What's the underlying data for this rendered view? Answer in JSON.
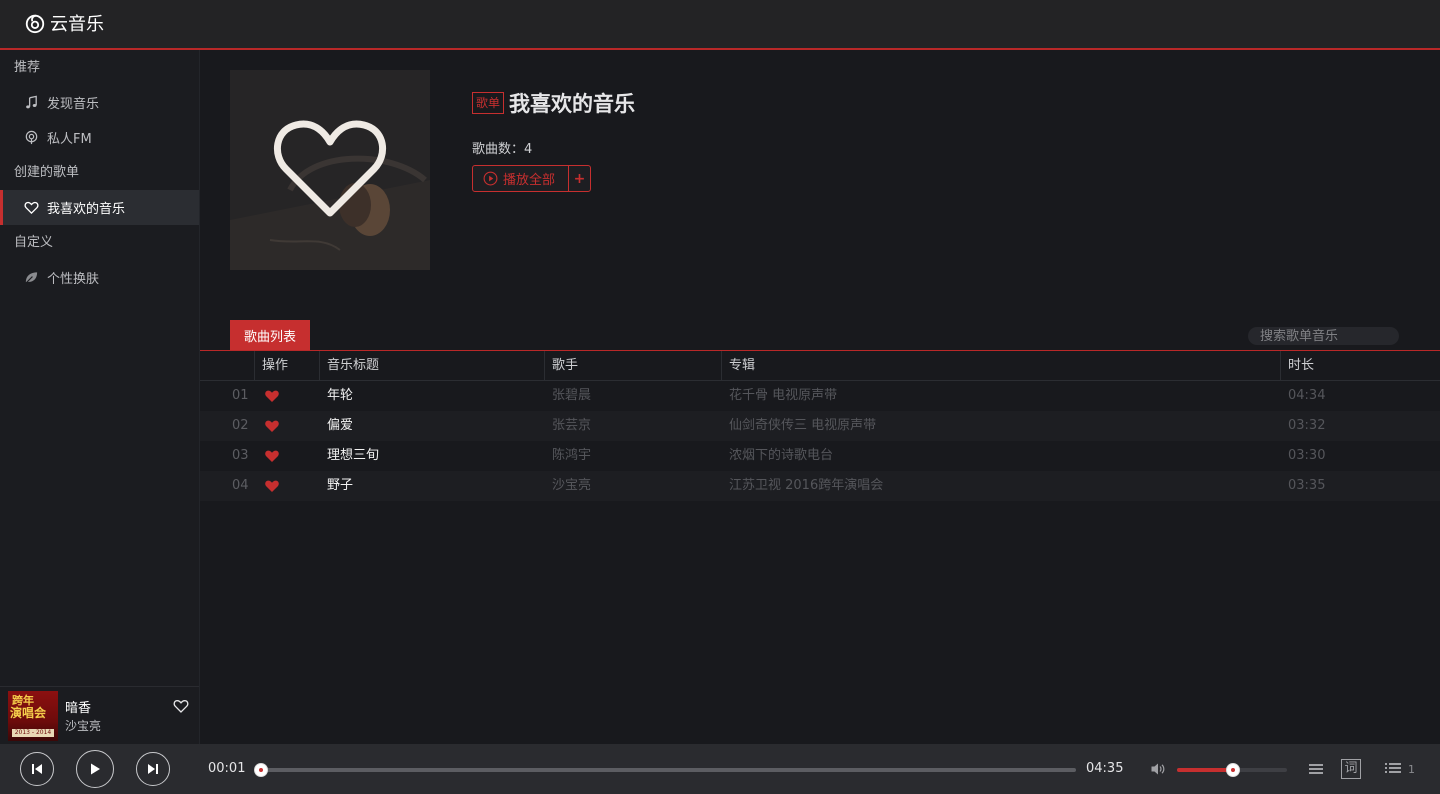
{
  "app": {
    "name": "云音乐",
    "accent": "#c62f2f"
  },
  "sidebar": {
    "groups": [
      {
        "title": "推荐",
        "items": [
          {
            "label": "发现音乐",
            "icon": "music-note-icon"
          },
          {
            "label": "私人FM",
            "icon": "radio-icon"
          }
        ]
      },
      {
        "title": "创建的歌单",
        "items": [
          {
            "label": "我喜欢的音乐",
            "icon": "heart-outline-icon",
            "active": true
          }
        ]
      },
      {
        "title": "自定义",
        "items": [
          {
            "label": "个性换肤",
            "icon": "leaf-icon"
          }
        ]
      }
    ],
    "now_playing": {
      "title": "暗香",
      "artist": "沙宝亮",
      "cover_text_top": "跨年",
      "cover_text_mid": "演唱会",
      "cover_text_bottom": "2013 - 2014"
    }
  },
  "playlist": {
    "tag": "歌单",
    "title": "我喜欢的音乐",
    "count_label": "歌曲数：",
    "count": "4",
    "play_all_label": "播放全部",
    "add_label": "+"
  },
  "tabs": {
    "active": "歌曲列表"
  },
  "search": {
    "placeholder": "搜索歌单音乐"
  },
  "table": {
    "headers": {
      "action": "操作",
      "title": "音乐标题",
      "artist": "歌手",
      "album": "专辑",
      "duration": "时长"
    },
    "rows": [
      {
        "index": "01",
        "title": "年轮",
        "artist": "张碧晨",
        "album": "花千骨 电视原声带",
        "duration": "04:34"
      },
      {
        "index": "02",
        "title": "偏爱",
        "artist": "张芸京",
        "album": "仙剑奇侠传三 电视原声带",
        "duration": "03:32"
      },
      {
        "index": "03",
        "title": "理想三旬",
        "artist": "陈鸿宇",
        "album": "浓烟下的诗歌电台",
        "duration": "03:30"
      },
      {
        "index": "04",
        "title": "野子",
        "artist": "沙宝亮",
        "album": "江苏卫视 2016跨年演唱会",
        "duration": "03:35"
      }
    ]
  },
  "player": {
    "current_time": "00:01",
    "total_time": "04:35",
    "progress": 0.004,
    "volume": 0.51,
    "lyric_label": "词",
    "queue_count": "1"
  }
}
